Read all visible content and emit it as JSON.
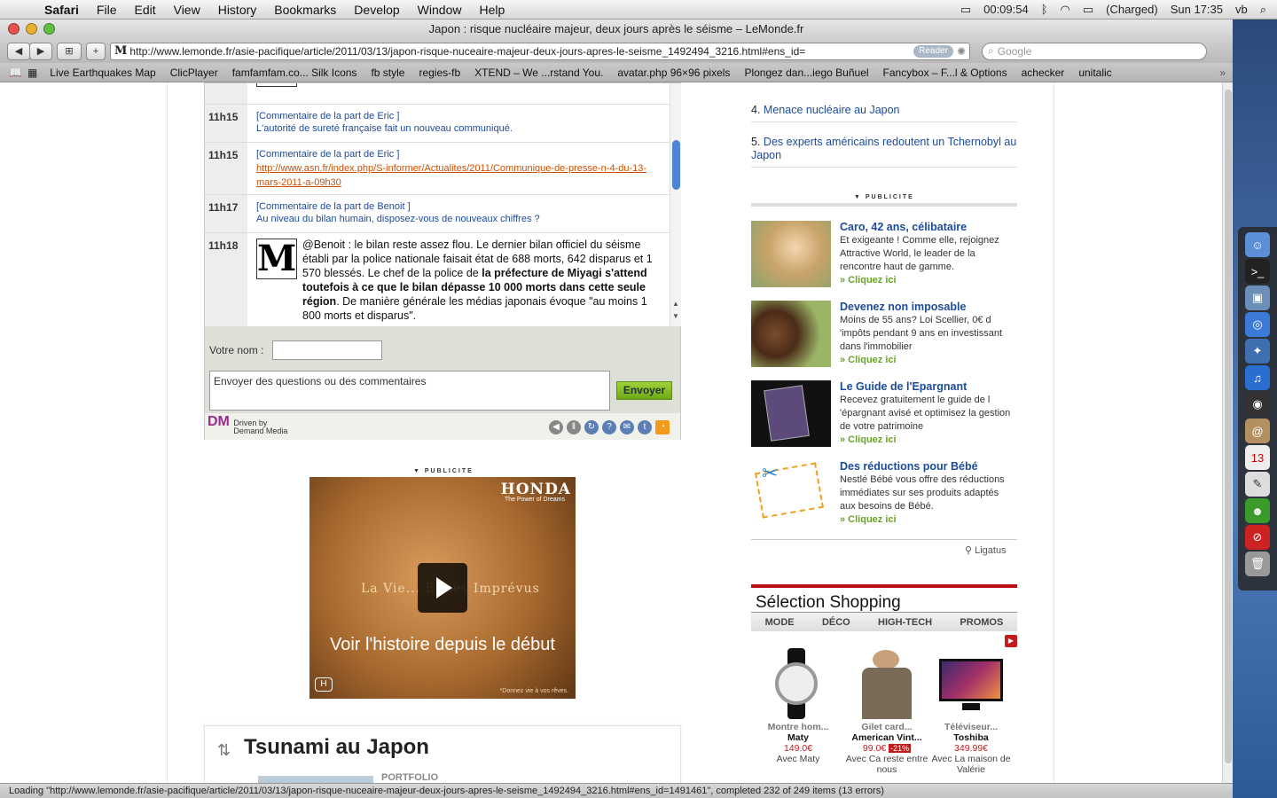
{
  "menubar": {
    "items": [
      "Safari",
      "File",
      "Edit",
      "View",
      "History",
      "Bookmarks",
      "Develop",
      "Window",
      "Help"
    ],
    "clock": "00:09:54",
    "battery": "(Charged)",
    "datetime": "Sun 17:35",
    "user": "vb"
  },
  "window": {
    "title": "Japon : risque nucléaire majeur, deux jours après le séisme – LeMonde.fr"
  },
  "toolbar": {
    "url": "http://www.lemonde.fr/asie-pacifique/article/2011/03/13/japon-risque-nuceaire-majeur-deux-jours-apres-le-seisme_1492494_3216.html#ens_id=",
    "reader_label": "Reader",
    "search_placeholder": "Google"
  },
  "bookmarks": [
    "Live Earthquakes Map",
    "ClicPlayer",
    "famfamfam.co... Silk Icons",
    "fb style",
    "regies-fb",
    "XTEND – We ...rstand You.",
    "avatar.php 96×96 pixels",
    "Plongez dan...iego Buñuel",
    "Fancybox – F...l & Options",
    "achecker",
    "unitalic"
  ],
  "live": {
    "rows": [
      {
        "time": "11h15",
        "who": "[Commentaire de la part de Eric ]",
        "msg": "L'autorité de sureté française fait un nouveau communiqué."
      },
      {
        "time": "11h15",
        "who": "[Commentaire de la part de Eric ]",
        "link": "http://www.asn.fr/index.php/S-informer/Actualites/2011/Communique-de-presse-n-4-du-13-mars-2011-a-09h30"
      },
      {
        "time": "11h17",
        "who": "[Commentaire de la part de Benoit ]",
        "msg": "Au niveau du bilan humain, disposez-vous de nouveaux chiffres ?"
      },
      {
        "time": "11h18",
        "text_a": "@Benoit : le bilan reste assez flou. Le dernier bilan officiel du séisme établi par la police nationale faisait état de 688 morts, 642 disparus et 1 570 blessés. Le chef de la police de ",
        "text_bold": "la préfecture de Miyagi s'attend toutefois à ce que le bilan dépasse 10 000 morts dans cette seule région",
        "text_b": ". De manière générale les médias japonais évoque \"au moins 1 800 morts et disparus\"."
      }
    ],
    "logo_glyph": "M",
    "name_label": "Votre nom :",
    "name_value": "",
    "comment_placeholder": "Envoyer des questions ou des commentaires",
    "send_label": "Envoyer",
    "driven_by": "Driven by",
    "demand_media": "Demand Media"
  },
  "ad": {
    "label": "PUBLICITE",
    "brand": "HONDA",
    "tagline": "The Power of Dreams",
    "headline": "La Vie... Et ses Imprévus",
    "cta": "Voir l'histoire depuis le début",
    "small": "*Donnez vie à vos rêves."
  },
  "tsunami": {
    "title": "Tsunami au Japon",
    "tag": "PORTFOLIO"
  },
  "rightcol": {
    "top_items": [
      {
        "num": "4.",
        "label": "Menace nucléaire au Japon"
      },
      {
        "num": "5.",
        "label": "Des experts américains redoutent un Tchernobyl au Japon"
      }
    ],
    "pub_label": "PUBLICITE",
    "promos": [
      {
        "title": "Caro, 42 ans, célibataire",
        "text": "Et exigeante ! Comme elle, rejoignez Attractive World, le leader de la rencontre haut de gamme.",
        "cta": "» Cliquez ici"
      },
      {
        "title": "Devenez non imposable",
        "text": "Moins de 55 ans? Loi Scellier, 0€ d 'impôts pendant 9 ans en investissant dans l'immobilier",
        "cta": "» Cliquez ici"
      },
      {
        "title": "Le Guide de l'Epargnant",
        "text": "Recevez gratuitement le guide de l 'épargnant avisé  et optimisez la gestion de votre patrimoine",
        "cta": "» Cliquez ici"
      },
      {
        "title": "Des réductions pour Bébé",
        "text": "Nestlé Bébé vous offre des réductions immédiates sur ses produits adaptés aux besoins de Bébé.",
        "cta": "» Cliquez ici"
      }
    ],
    "ligatus": "Ligatus",
    "shop_title": "Sélection Shopping",
    "shop_tabs": [
      "MODE",
      "DÉCO",
      "HIGH-TECH",
      "PROMOS"
    ],
    "products": [
      {
        "name": "Montre hom...",
        "brand": "Maty",
        "price": "149.0€",
        "discount": "",
        "shop": "Avec Maty"
      },
      {
        "name": "Gilet card...",
        "brand": "American Vint...",
        "price": "99.0€",
        "discount": "-21%",
        "shop": "Avec Ca reste entre nous"
      },
      {
        "name": "Téléviseur...",
        "brand": "Toshiba",
        "price": "349.99€",
        "discount": "",
        "shop": "Avec La maison de Valérie"
      }
    ]
  },
  "status": "Loading \"http://www.lemonde.fr/asie-pacifique/article/2011/03/13/japon-risque-nuceaire-majeur-deux-jours-apres-le-seisme_1492494_3216.html#ens_id=1491461\", completed 232 of 249 items (13 errors)"
}
